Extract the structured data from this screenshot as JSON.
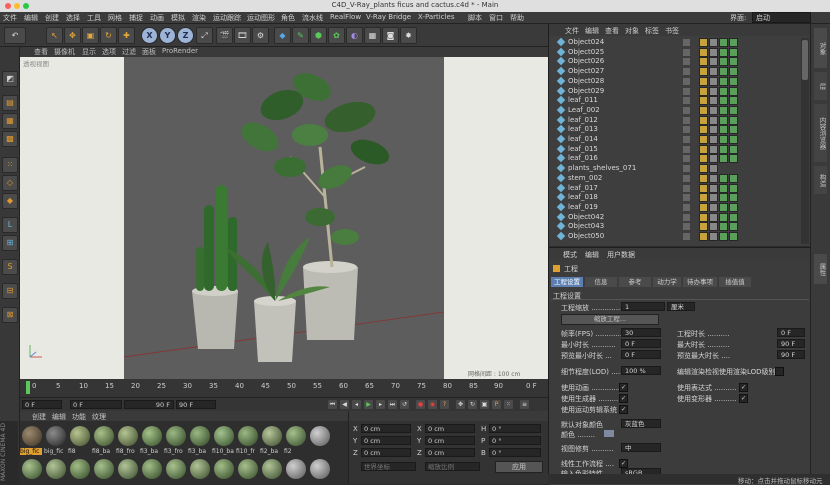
{
  "window": {
    "title": "C4D_V-Ray_plants ficus and cactus.c4d * - Main"
  },
  "menu": [
    "文件",
    "编辑",
    "创建",
    "选择",
    "工具",
    "网格",
    "捕捉",
    "动画",
    "模拟",
    "渲染",
    "运动跟踪",
    "运动图形",
    "角色",
    "流水线",
    "RealFlow",
    "V-Ray Bridge",
    "X-Particles",
    "脚本",
    "窗口",
    "帮助"
  ],
  "layout": {
    "label": "界面:",
    "value": "启动"
  },
  "toolbar": {
    "x": "X",
    "y": "Y",
    "z": "Z"
  },
  "viewport_menu": [
    "查看",
    "摄像机",
    "显示",
    "选项",
    "过滤",
    "面板",
    "ProRender"
  ],
  "viewport": {
    "corner_label": "透视视图",
    "grid_label": "网格间距 : 100 cm"
  },
  "timeline": {
    "ticks": [
      "0",
      "5",
      "10",
      "15",
      "20",
      "25",
      "30",
      "35",
      "40",
      "45",
      "50",
      "55",
      "60",
      "65",
      "70",
      "75",
      "80",
      "85",
      "90"
    ],
    "current_frame": "0 F",
    "start": "0 F",
    "end": "90 F",
    "end2": "90 F",
    "frame_right": "0 F"
  },
  "material_menu": [
    "创建",
    "编辑",
    "功能",
    "纹理"
  ],
  "materials": [
    "big_fic",
    "big_fic",
    "fi8",
    "fi8_ba",
    "fi8_fro",
    "fi3_ba",
    "fi3_fro",
    "fi3_ba",
    "fi10_ba",
    "fi10_fr",
    "fi2_ba",
    "fi2"
  ],
  "materials_row2": [
    "",
    "",
    "",
    "",
    "",
    "",
    "",
    "",
    "",
    "",
    "",
    ""
  ],
  "coords": {
    "x": "0 cm",
    "y": "0 cm",
    "z": "0 cm",
    "x2": "0 cm",
    "y2": "0 cm",
    "z2": "0 cm",
    "h": "0 °",
    "p": "0 °",
    "b": "0 °",
    "l_x": "X",
    "l_y": "Y",
    "l_z": "Z",
    "l_x2": "X",
    "l_y2": "Y",
    "l_z2": "Z",
    "l_h": "H",
    "l_p": "P",
    "l_b": "B",
    "world": "世界坐标",
    "scale": "缩放比例",
    "apply": "应用"
  },
  "objmgr": {
    "menu": [
      "文件",
      "编辑",
      "查看",
      "对象",
      "标签",
      "书签"
    ],
    "objects": [
      "Object024",
      "Object025",
      "Object026",
      "Object027",
      "Object028",
      "Object029",
      "leaf_011",
      "Leaf_002",
      "leaf_012",
      "leaf_013",
      "leaf_014",
      "leaf_015",
      "leaf_016",
      "plants_shelves_071",
      "stem_002",
      "leaf_017",
      "leaf_018",
      "leaf_019",
      "Object042",
      "Object043",
      "Object050"
    ]
  },
  "attr": {
    "menu": [
      "模式",
      "编辑",
      "用户数据"
    ],
    "title": "工程",
    "tabs": [
      "工程设置",
      "信息",
      "参考",
      "动力学",
      "待办事项",
      "插值值"
    ],
    "section": "工程设置",
    "scale_label": "工程缩放 ...............",
    "scale_value": "1",
    "scale_unit": "厘米",
    "scale_btn": "缩放工程...",
    "fps_label": "帧率(FPS) ............",
    "fps": "30",
    "proj_time_label": "工程时长 ..........",
    "proj_time": "0 F",
    "min_label": "最小时长 ...........",
    "min": "0 F",
    "max_label": "最大时长 ..........",
    "max": "90 F",
    "pmin_label": "预览最小时长 ...",
    "pmin": "0 F",
    "pmax_label": "预览最大时长 ....",
    "pmax": "90 F",
    "lod_label": "细节程度(LOD) .....",
    "lod": "100 %",
    "lod_render": "编辑渲染检视使用渲染LOD级别",
    "anim_label": "使用动画 ..............",
    "expr_label": "使用表达式 ..........",
    "gen_label": "使用生成器 ............",
    "deform_label": "使用变形器 ..........",
    "motion_label": "使用运动剪辑系统",
    "default_color_label": "默认对象颜色",
    "default_color": "灰蓝色",
    "color_label": "颜色 ........",
    "view_label": "视图修剪 ..........",
    "view": "中",
    "linear_label": "线性工作流程 ....",
    "input_label": "输入色彩特性 .......",
    "input": "sRGB"
  },
  "right_strip": [
    "对象",
    "层",
    "内容浏览器",
    "构造",
    "属性"
  ],
  "status": "移动：点击并拖动鼠标移动元"
}
